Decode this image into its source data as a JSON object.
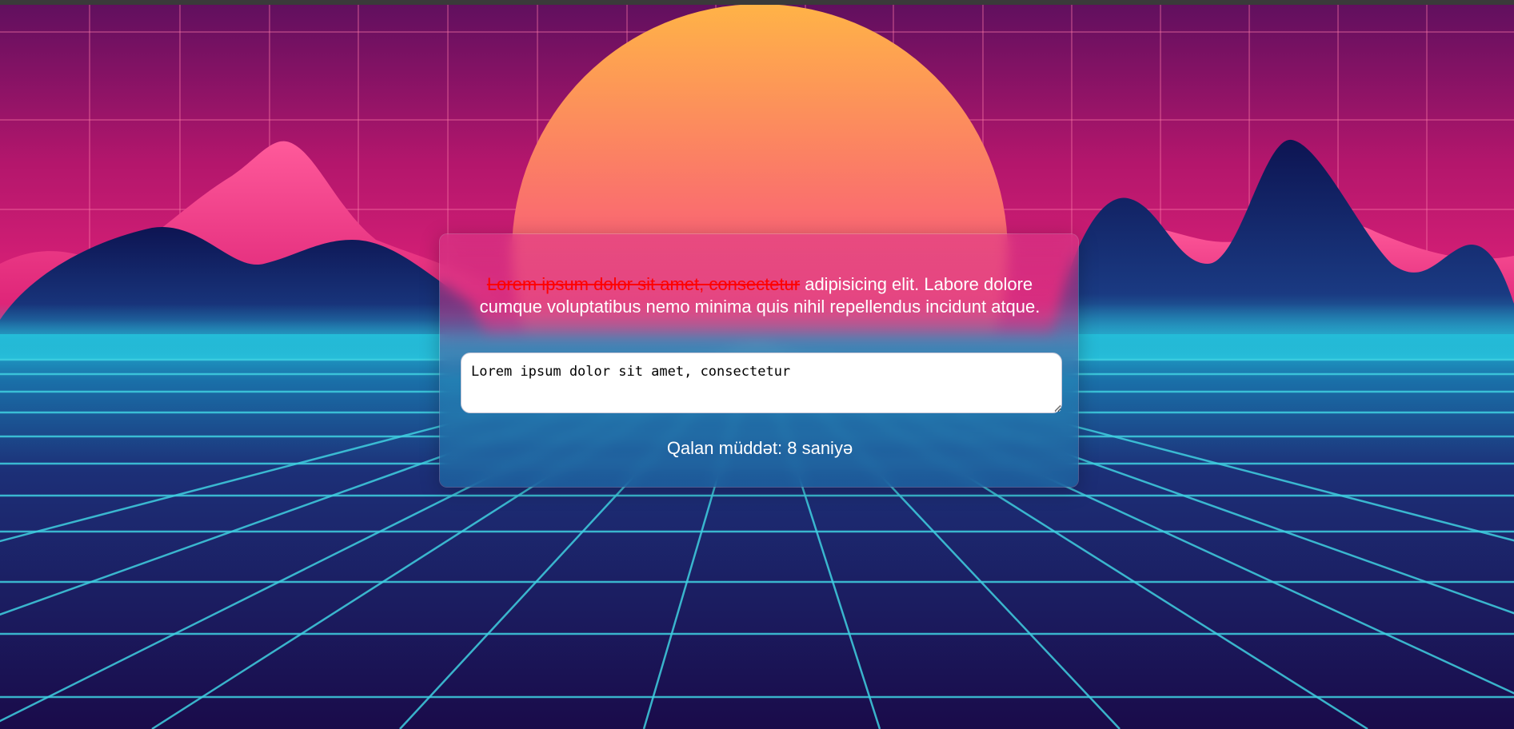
{
  "typing_test": {
    "typed_text": "Lorem ipsum dolor sit amet, consectetur",
    "remaining_text": " adipisicing elit. Labore dolore cumque voluptatibus nemo minima quis nihil repellendus incidunt atque.",
    "input_value": "Lorem ipsum dolor sit amet, consectetur",
    "timer_text": "Qalan müddət: 8 saniyə"
  },
  "colors": {
    "typed_text": "#ff0000",
    "sun_top": "#ffb347",
    "sun_bottom": "#ff2d8a",
    "grid_lines": "#3fd0e0",
    "floor": "#1a0b4a"
  }
}
